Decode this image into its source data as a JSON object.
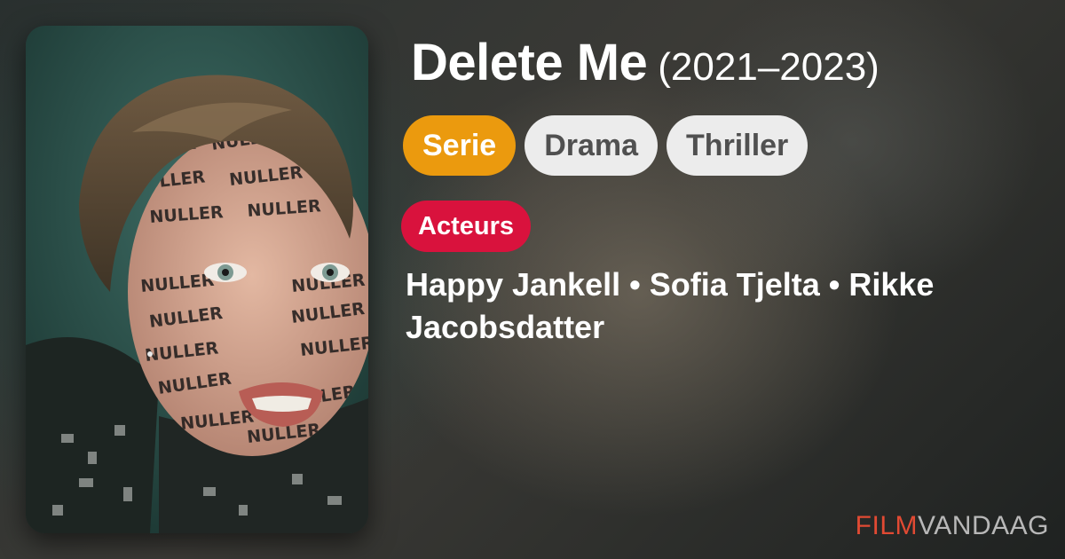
{
  "title": {
    "name": "Delete Me",
    "years": "(2021–2023)"
  },
  "tags": [
    {
      "label": "Serie",
      "kind": "primary"
    },
    {
      "label": "Drama",
      "kind": "secondary"
    },
    {
      "label": "Thriller",
      "kind": "secondary"
    }
  ],
  "actors": {
    "badge": "Acteurs",
    "text": "Happy Jankell • Sofia Tjelta • Rikke Jacobsdatter"
  },
  "poster": {
    "face_writing": "NULLER"
  },
  "brand": {
    "part1": "FILM",
    "part2": "VANDAAG"
  },
  "colors": {
    "primary_tag": "#eb9a0e",
    "secondary_tag": "#ececec",
    "actors_badge": "#d9123d",
    "brand_accent": "#e14a33"
  }
}
